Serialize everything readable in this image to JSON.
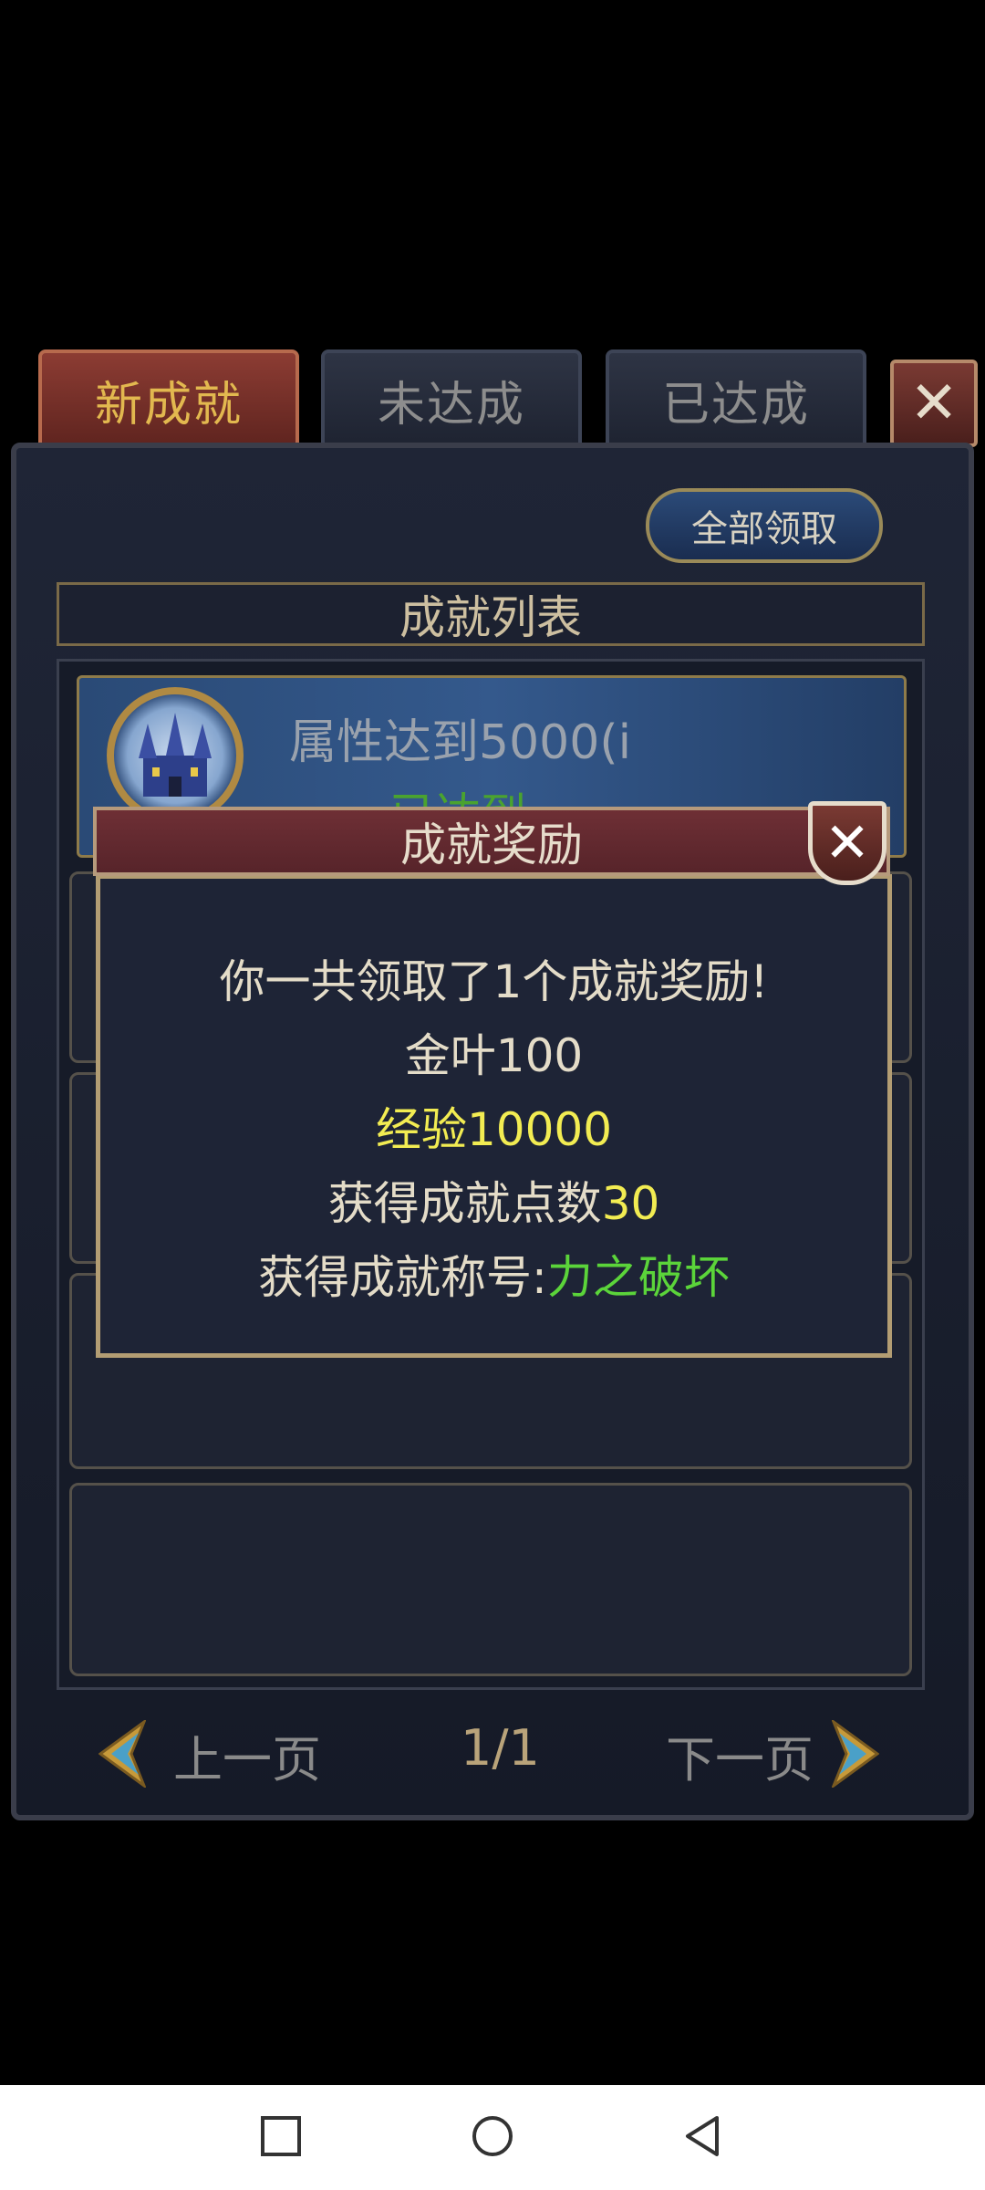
{
  "tabs": {
    "new": "新成就",
    "unreached": "未达成",
    "reached": "已达成",
    "close": "✕"
  },
  "claim_all": "全部领取",
  "list_header": "成就列表",
  "achievement": {
    "name": "属性达到5000(i",
    "status": "已达到"
  },
  "dialog": {
    "title": "成就奖励",
    "close": "✕",
    "line1": "你一共领取了1个成就奖励!",
    "line2": "金叶100",
    "line3": "经验10000",
    "line4_prefix": "获得成就点数",
    "line4_value": "30",
    "line5_prefix": "获得成就称号:",
    "line5_value": "力之破坏"
  },
  "pagination": {
    "prev": "上一页",
    "page": "1/1",
    "next": "下一页"
  },
  "colors": {
    "yellow": "#f2ec52",
    "green": "#5bd43a",
    "tab_active": "#8c3c33"
  }
}
